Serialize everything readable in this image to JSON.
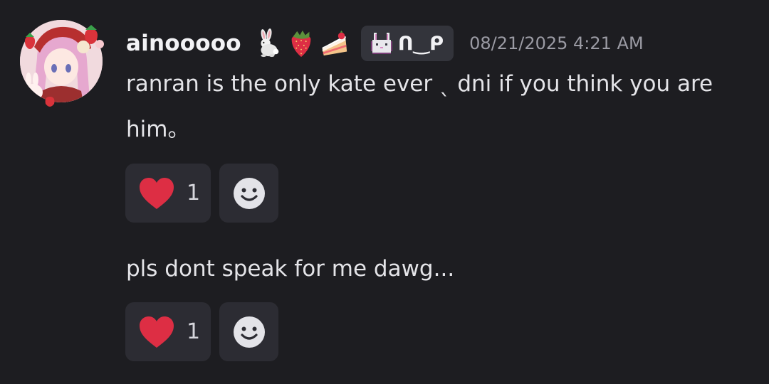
{
  "author": {
    "username": "ainooooo",
    "avatar_icon": "anime-girl-strawberry-avatar",
    "emojis": [
      "rabbit-icon",
      "strawberry-icon",
      "cake-icon"
    ],
    "tag": {
      "icon": "pixel-bunny-icon",
      "text": "ᑎ‿ᑭ"
    },
    "timestamp": "08/21/2025 4:21 AM"
  },
  "messages": [
    {
      "text": "ranran is the only kate ever ˎ dni if you think you are him。",
      "reactions": [
        {
          "icon": "heart-icon",
          "count": "1",
          "color": "#dd2e44"
        }
      ]
    },
    {
      "text": "pls dont speak for me dawg...",
      "reactions": [
        {
          "icon": "heart-icon",
          "count": "1",
          "color": "#dd2e44"
        }
      ]
    }
  ],
  "colors": {
    "background": "#1d1d21",
    "reaction_background": "#2c2c33",
    "timestamp": "#9b9ba4",
    "heart": "#dd2e44"
  }
}
